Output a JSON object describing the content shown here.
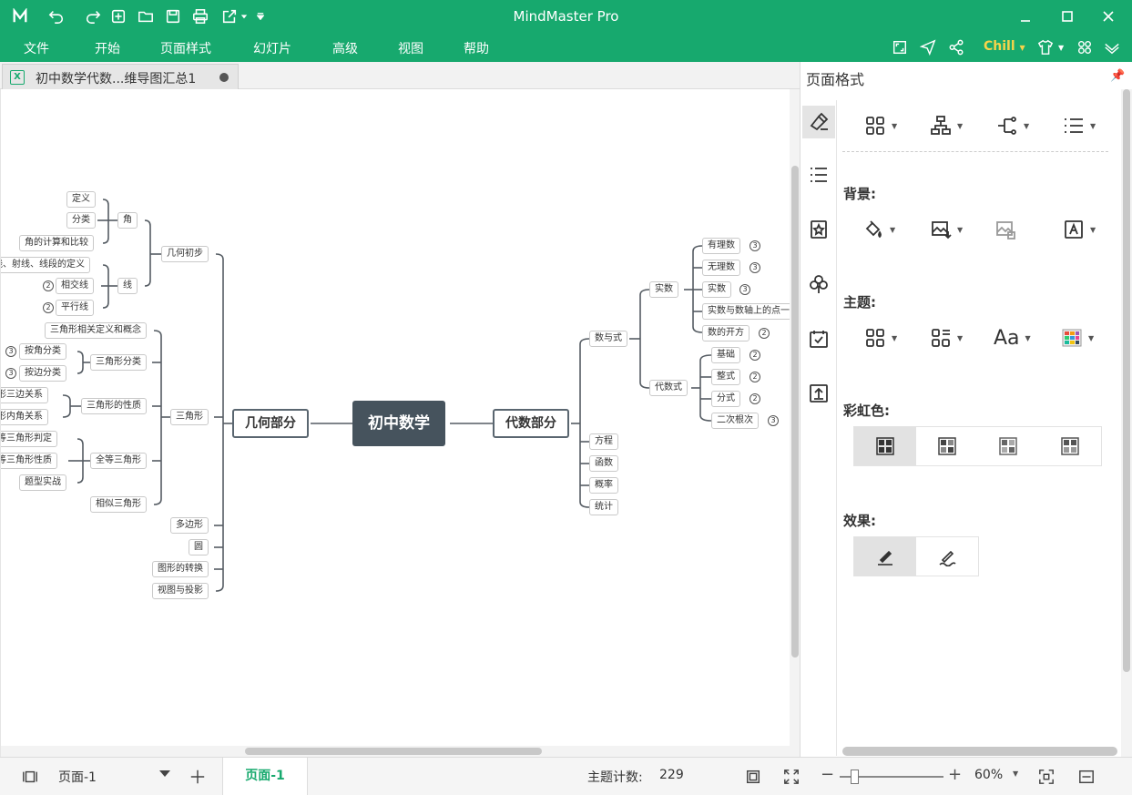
{
  "titlebar": {
    "app_title": "MindMaster Pro"
  },
  "menubar": {
    "items": [
      "文件",
      "开始",
      "页面样式",
      "幻灯片",
      "高级",
      "视图",
      "帮助"
    ],
    "theme_label": "Chill"
  },
  "doc_tab": {
    "label": "初中数学代数...维导图汇总1"
  },
  "mindmap": {
    "root": "初中数学",
    "left_branch": "几何部分",
    "right_branch": "代数部分",
    "left": {
      "group1": {
        "label": "几何初步",
        "angle": {
          "label": "角",
          "children": [
            "定义",
            "分类",
            "角的计算和比较"
          ]
        },
        "line": {
          "label": "线",
          "children": [
            "线、射线、线段的定义",
            "相交线",
            "平行线"
          ],
          "badges": [
            "2",
            "2"
          ]
        }
      },
      "group2": {
        "label": "三角形",
        "children": [
          "三角形相关定义和概念",
          "三角形分类",
          "三角形的性质",
          "全等三角形",
          "相似三角形"
        ],
        "classify": [
          "按角分类",
          "按边分类"
        ],
        "classify_badges": [
          "3",
          "3"
        ],
        "props": [
          "三角形三边关系",
          "三角形内角关系"
        ],
        "congruent": [
          "全等三角形判定",
          "全等三角形性质",
          "题型实战"
        ]
      },
      "others": [
        "多边形",
        "圆",
        "图形的转换",
        "视图与投影"
      ]
    },
    "right": {
      "shuyushi": {
        "label": "数与式",
        "real": {
          "label": "实数",
          "children": [
            "有理数",
            "无理数",
            "实数",
            "实数与数轴上的点一",
            "数的开方"
          ],
          "badges": [
            "3",
            "3",
            "3",
            "2"
          ]
        },
        "algebra": {
          "label": "代数式",
          "children": [
            "基础",
            "整式",
            "分式",
            "二次根次"
          ],
          "badges": [
            "2",
            "2",
            "2",
            "3"
          ]
        }
      },
      "others": [
        "方程",
        "函数",
        "概率",
        "统计"
      ]
    }
  },
  "panel": {
    "title": "页面格式",
    "background_label": "背景:",
    "theme_label": "主题:",
    "rainbow_label": "彩虹色:",
    "effect_label": "效果:"
  },
  "statusbar": {
    "page_select": "页面-1",
    "active_page": "页面-1",
    "topic_count_label": "主题计数:",
    "topic_count": "229",
    "zoom": "60%"
  }
}
